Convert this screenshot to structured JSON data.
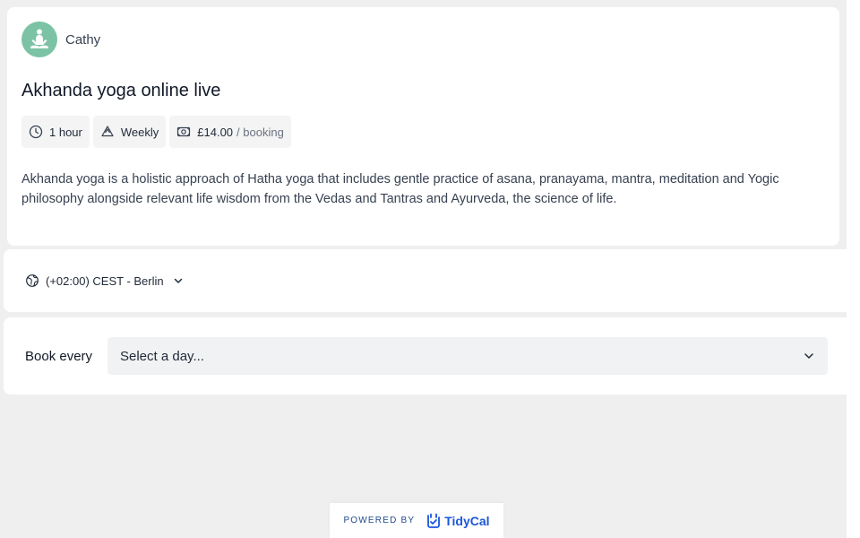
{
  "host": {
    "name": "Cathy",
    "avatar_color": "#7cc3a5",
    "avatar_icon": "meditation-icon"
  },
  "event": {
    "title": "Akhanda yoga online live",
    "duration": "1 hour",
    "recurrence": "Weekly",
    "price": "£14.00",
    "price_unit": "/ booking",
    "description": "Akhanda yoga is a holistic approach of Hatha yoga that includes gentle practice of asana, pranayama, mantra, meditation and Yogic philosophy alongside relevant life wisdom from the Vedas and Tantras and Ayurveda, the science of life."
  },
  "timezone": {
    "label": "(+02:00) CEST - Berlin",
    "icon": "globe-icon"
  },
  "booking": {
    "label": "Book every",
    "select_placeholder": "Select a day..."
  },
  "footer": {
    "powered_by": "POWERED BY",
    "brand": "TidyCal",
    "brand_color": "#1a56db"
  }
}
